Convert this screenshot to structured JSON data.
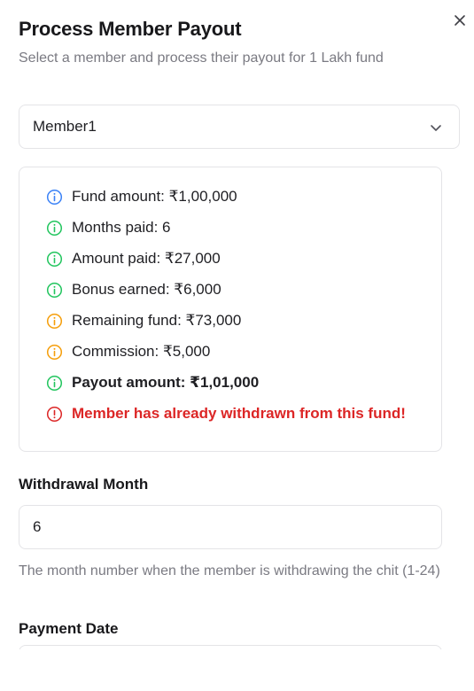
{
  "dialog": {
    "title": "Process Member Payout",
    "subtitle": "Select a member and process their payout for 1 Lakh fund"
  },
  "member_select": {
    "selected": "Member1"
  },
  "info": {
    "items": [
      {
        "text": "Fund amount: ₹1,00,000",
        "icon": "info-icon",
        "color": "#3b82f6",
        "style": "normal"
      },
      {
        "text": "Months paid: 6",
        "icon": "info-icon",
        "color": "#22c55e",
        "style": "normal"
      },
      {
        "text": "Amount paid: ₹27,000",
        "icon": "info-icon",
        "color": "#22c55e",
        "style": "normal"
      },
      {
        "text": "Bonus earned: ₹6,000",
        "icon": "info-icon",
        "color": "#22c55e",
        "style": "normal"
      },
      {
        "text": "Remaining fund: ₹73,000",
        "icon": "info-icon",
        "color": "#f59e0b",
        "style": "normal"
      },
      {
        "text": "Commission: ₹5,000",
        "icon": "info-icon",
        "color": "#f59e0b",
        "style": "normal"
      },
      {
        "text": "Payout amount: ₹1,01,000",
        "icon": "info-icon",
        "color": "#22c55e",
        "style": "bold"
      },
      {
        "text": "Member has already withdrawn from this fund!",
        "icon": "alert-icon",
        "color": "#dc2626",
        "style": "error"
      }
    ]
  },
  "withdrawal_month": {
    "label": "Withdrawal Month",
    "value": "6",
    "help": "The month number when the member is withdrawing the chit (1-24)"
  },
  "payment_date": {
    "label": "Payment Date"
  }
}
